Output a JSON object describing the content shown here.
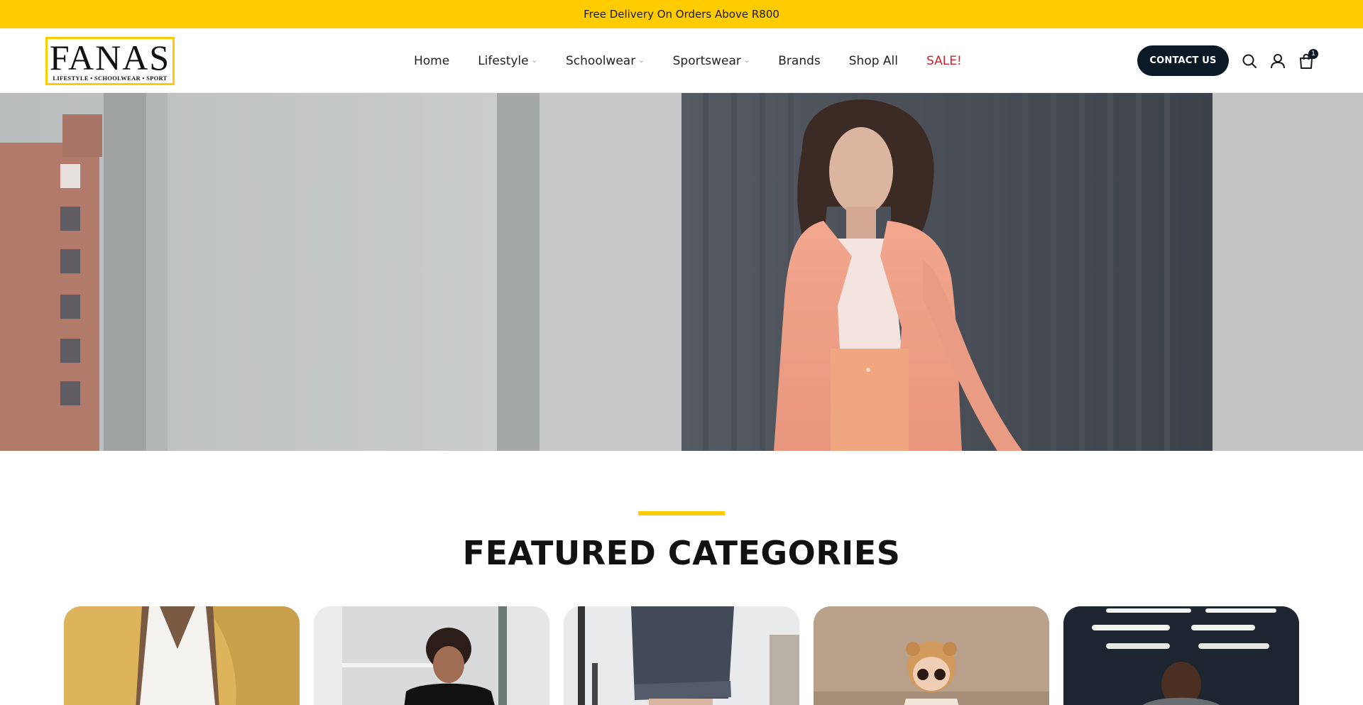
{
  "announcement": {
    "text": "Free Delivery On Orders Above R800"
  },
  "logo": {
    "word": "FANAS",
    "tagline": "LIFESTYLE • SCHOOLWEAR • SPORT"
  },
  "nav": {
    "items": [
      {
        "label": "Home",
        "has_dropdown": false
      },
      {
        "label": "Lifestyle",
        "has_dropdown": true
      },
      {
        "label": "Schoolwear",
        "has_dropdown": true
      },
      {
        "label": "Sportswear",
        "has_dropdown": true
      },
      {
        "label": "Brands",
        "has_dropdown": false
      },
      {
        "label": "Shop All",
        "has_dropdown": false
      },
      {
        "label": "SALE!",
        "has_dropdown": false
      }
    ],
    "dropdown_glyph": "⌄"
  },
  "header_actions": {
    "contact_label": "CONTACT US",
    "icons": [
      "search-icon",
      "account-icon",
      "shopping-bag-icon"
    ],
    "cart_count": "1"
  },
  "featured": {
    "title": "FEATURED CATEGORIES"
  },
  "colors": {
    "brand_yellow": "#ffcc00",
    "dark_navy": "#0b1a26",
    "sale_red": "#d0212a"
  }
}
